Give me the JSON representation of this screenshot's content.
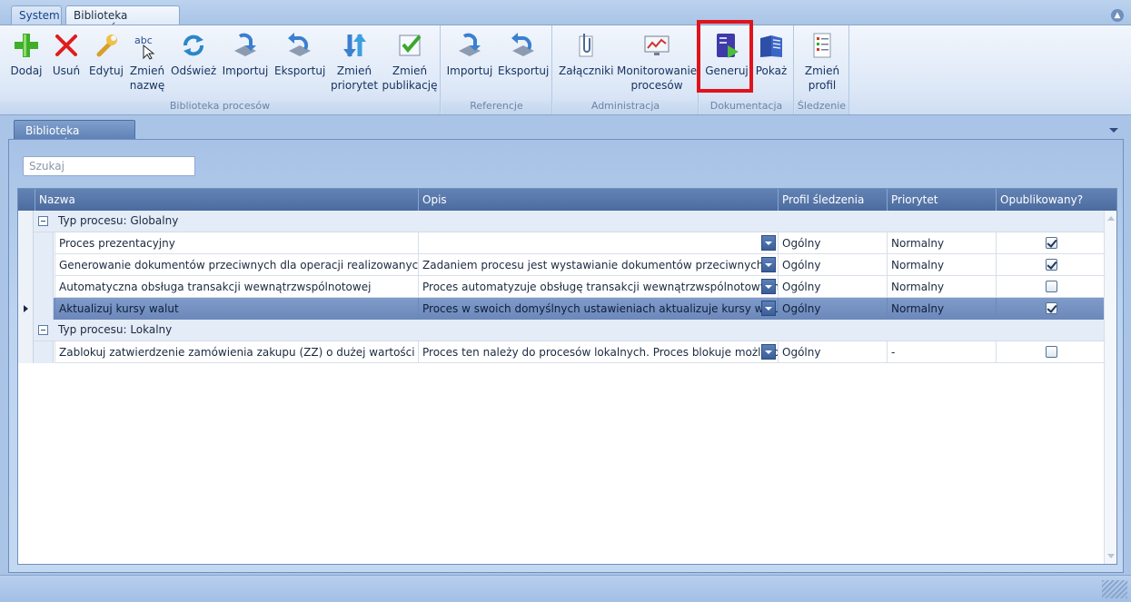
{
  "top_tabs": {
    "system": "System",
    "library": "Biblioteka procesów"
  },
  "ribbon": {
    "groups": {
      "library": "Biblioteka procesów",
      "references": "Referencje",
      "administration": "Administracja",
      "documentation": "Dokumentacja",
      "tracking": "Śledzenie"
    },
    "buttons": {
      "add": "Dodaj",
      "delete": "Usuń",
      "edit": "Edytuj",
      "rename_1": "Zmień",
      "rename_2": "nazwę",
      "refresh": "Odśwież",
      "import": "Importuj",
      "export": "Eksportuj",
      "priority_1": "Zmień",
      "priority_2": "priorytet",
      "publication_1": "Zmień",
      "publication_2": "publikację",
      "ref_import": "Importuj",
      "ref_export": "Eksportuj",
      "attachments": "Załączniki",
      "monitoring_1": "Monitorowanie",
      "monitoring_2": "procesów",
      "generate": "Generuj",
      "show": "Pokaż",
      "profile_1": "Zmień",
      "profile_2": "profil"
    }
  },
  "doc_tab": "Biblioteka procesów",
  "search": {
    "placeholder": "Szukaj"
  },
  "grid": {
    "columns": [
      "Nazwa",
      "Opis",
      "Profil śledzenia",
      "Priorytet",
      "Opublikowany?"
    ],
    "groups": [
      {
        "label": "Typ procesu: Globalny",
        "rows": [
          {
            "name": "Proces prezentacyjny",
            "desc": "",
            "profile": "Ogólny",
            "priority": "Normalny",
            "published": true
          },
          {
            "name": "Generowanie dokumentów przeciwnych dla operacji realizowanych pom...",
            "desc": "Zadaniem procesu jest wystawianie dokumentów przeciwnych w przyp",
            "profile": "Ogólny",
            "priority": "Normalny",
            "published": true
          },
          {
            "name": "Automatyczna obsługa transakcji wewnątrzwspólnotowej",
            "desc": "Proces automatyzuje obsługę transakcji wewnątrzwspólnotowych reje",
            "profile": "Ogólny",
            "priority": "Normalny",
            "published": false
          },
          {
            "name": "Aktualizuj kursy walut",
            "desc": "Proces w swoich domyślnych ustawieniach aktualizuje kursy walut dla",
            "profile": "Ogólny",
            "priority": "Normalny",
            "published": true,
            "selected": true
          }
        ]
      },
      {
        "label": "Typ procesu: Lokalny",
        "rows": [
          {
            "name": "Zablokuj zatwierdzenie zamówienia zakupu (ZZ) o dużej wartości (lokalny)",
            "desc": "Proces ten należy do procesów lokalnych. Proces blokuje możliwość z",
            "profile": "Ogólny",
            "priority": "-",
            "published": false
          }
        ]
      }
    ]
  }
}
